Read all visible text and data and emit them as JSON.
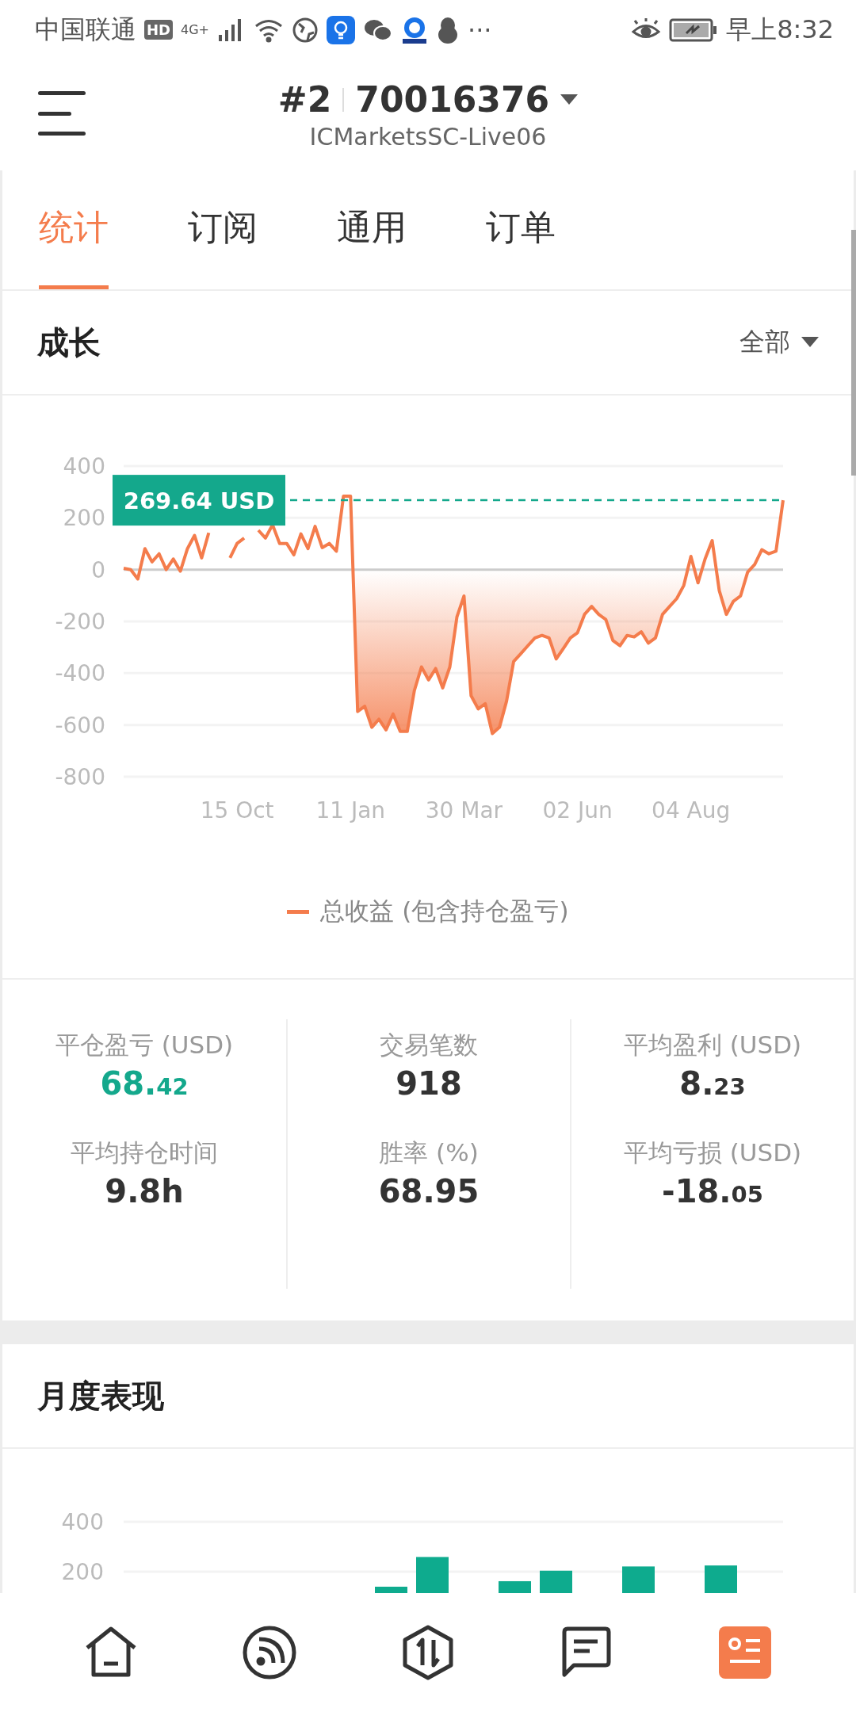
{
  "status_bar": {
    "carrier": "中国联通",
    "hd": "HD",
    "network": "4G+",
    "more": "···",
    "time": "早上8:32"
  },
  "header": {
    "account_index": "#2",
    "account_number": "70016376",
    "server": "ICMarketsSC-Live06"
  },
  "tabs": [
    {
      "label": "统计",
      "selected": true
    },
    {
      "label": "订阅",
      "selected": false
    },
    {
      "label": "通用",
      "selected": false
    },
    {
      "label": "订单",
      "selected": false
    }
  ],
  "growth": {
    "title": "成长",
    "period": "全部",
    "chart_data": {
      "type": "area",
      "ylim": [
        -800,
        400
      ],
      "yticks": [
        400,
        200,
        0,
        -200,
        -400,
        -600,
        -800
      ],
      "categories": [
        null,
        null,
        null,
        null,
        null,
        null,
        null,
        null,
        null,
        null,
        null,
        null,
        null,
        null,
        null,
        null,
        "15 Oct",
        null,
        null,
        null,
        null,
        null,
        null,
        null,
        null,
        null,
        null,
        null,
        null,
        null,
        null,
        null,
        "11 Jan",
        null,
        null,
        null,
        null,
        null,
        null,
        null,
        null,
        null,
        null,
        null,
        null,
        null,
        null,
        null,
        "30 Mar",
        null,
        null,
        null,
        null,
        null,
        null,
        null,
        null,
        null,
        null,
        null,
        null,
        null,
        null,
        null,
        "02 Jun",
        null,
        null,
        null,
        null,
        null,
        null,
        null,
        null,
        null,
        null,
        null,
        null,
        null,
        null,
        null,
        "04 Aug",
        null,
        null,
        null,
        null,
        null,
        null,
        null,
        null,
        null,
        null,
        null,
        null,
        null
      ],
      "series": [
        {
          "name": "总收益 (包含持仓盈亏)",
          "color": "#f47c4c",
          "values": [
            5,
            0,
            -36,
            81,
            30,
            61,
            0,
            41,
            -6,
            81,
            132,
            45,
            142,
            null,
            null,
            45,
            101,
            122,
            null,
            152,
            122,
            173,
            101,
            101,
            57,
            138,
            81,
            167,
            85,
            101,
            71,
            284,
            284,
            -548,
            -528,
            -609,
            -578,
            -619,
            -558,
            -625,
            -625,
            -467,
            -376,
            -426,
            -382,
            -457,
            -376,
            -183,
            -102,
            -487,
            -538,
            -518,
            -633,
            -609,
            -508,
            -355,
            -325,
            -294,
            -264,
            -254,
            -264,
            -345,
            -305,
            -264,
            -244,
            -173,
            -142,
            -173,
            -193,
            -274,
            -294,
            -254,
            -260,
            -240,
            -284,
            -264,
            -173,
            -142,
            -112,
            -61,
            51,
            -51,
            41,
            112,
            -81,
            -173,
            -122,
            -102,
            -10,
            20,
            77,
            61,
            71,
            268
          ]
        }
      ],
      "grid": true,
      "ref_lines": [
        {
          "label": "269.64 USD"
        }
      ]
    }
  },
  "stats": [
    {
      "label": "平仓盈亏 (USD)",
      "value": "68.",
      "decimals": "42",
      "color": "#14a88c"
    },
    {
      "label": "交易笔数",
      "value": "918",
      "color": "#333333"
    },
    {
      "label": "平均盈利 (USD)",
      "value": "8.",
      "decimals": "23",
      "color": "#333333"
    },
    {
      "label": "平均持仓时间",
      "value": "9.8h",
      "color": "#333333"
    },
    {
      "label": "胜率 (%)",
      "value": "68.95",
      "color": "#333333"
    },
    {
      "label": "平均亏损 (USD)",
      "value": "-18.",
      "decimals": "05",
      "color": "#333333"
    }
  ],
  "monthly": {
    "title": "月度表现",
    "chart_data": {
      "type": "bar",
      "yticks": [
        200,
        400
      ],
      "ylim": [
        0,
        400
      ],
      "series": [
        {
          "color": "#0eab8e",
          "values": [
            null,
            null,
            null,
            null,
            null,
            null,
            140,
            259,
            null,
            162,
            204,
            null,
            221,
            null,
            225,
            null
          ]
        }
      ]
    }
  }
}
